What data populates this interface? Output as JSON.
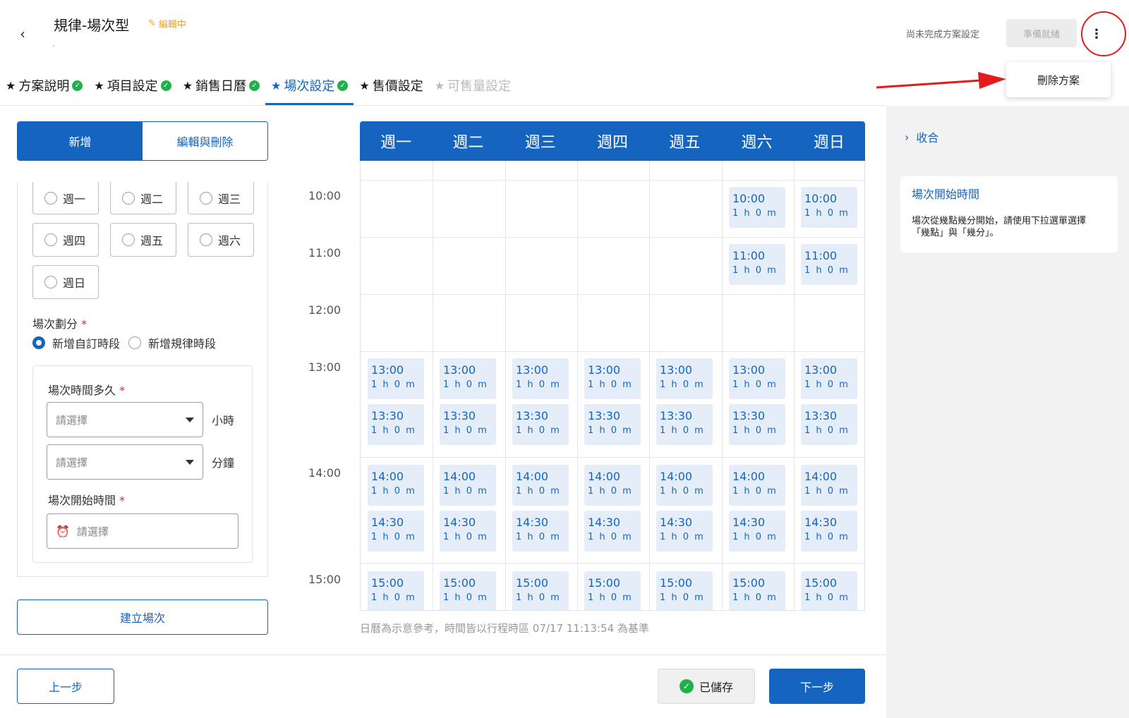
{
  "header": {
    "title": "規律-場次型",
    "editing_label": "編輯中",
    "subtitle": "-",
    "status_text": "尚未完成方案設定",
    "ready_button": "準備就緒",
    "more_icon": "⋮",
    "dropdown_item": "刪除方案"
  },
  "steps": [
    {
      "label": "方案說明",
      "state": "done"
    },
    {
      "label": "項目設定",
      "state": "done"
    },
    {
      "label": "銷售日曆",
      "state": "done"
    },
    {
      "label": "場次設定",
      "state": "active"
    },
    {
      "label": "售價設定",
      "state": "todo"
    },
    {
      "label": "可售量設定",
      "state": "disabled"
    }
  ],
  "form": {
    "tab_add": "新增",
    "tab_edit": "編輯與刪除",
    "days": [
      "週一",
      "週二",
      "週三",
      "週四",
      "週五",
      "週六",
      "週日"
    ],
    "session_split_label": "場次劃分",
    "option_custom": "新增自訂時段",
    "option_regular": "新增規律時段",
    "duration_label": "場次時間多久",
    "hour_placeholder": "請選擇",
    "hour_unit": "小時",
    "minute_placeholder": "請選擇",
    "minute_unit": "分鐘",
    "start_time_label": "場次開始時間",
    "start_time_placeholder": "請選擇",
    "build_button": "建立場次"
  },
  "calendar": {
    "weekdays": [
      "週一",
      "週二",
      "週三",
      "週四",
      "週五",
      "週六",
      "週日"
    ],
    "time_labels": [
      "10:00",
      "11:00",
      "12:00",
      "13:00",
      "14:00",
      "15:00"
    ],
    "slot_duration": "1 h 0 m",
    "note": "日曆為示意參考，時間皆以行程時區  07/17 11:13:54 為基準"
  },
  "help": {
    "collapse_label": "收合",
    "title": "場次開始時間",
    "body": "場次從幾點幾分開始，請使用下拉選單選擇 「幾點」與「幾分」。"
  },
  "footer": {
    "prev_button": "上一步",
    "saved_button": "已儲存",
    "next_button": "下一步"
  },
  "colors": {
    "primary": "#1565c0",
    "success": "#22b04b",
    "warning": "#f0a020",
    "annotation": "#e41b1b",
    "slot_bg": "#e5edf9"
  }
}
